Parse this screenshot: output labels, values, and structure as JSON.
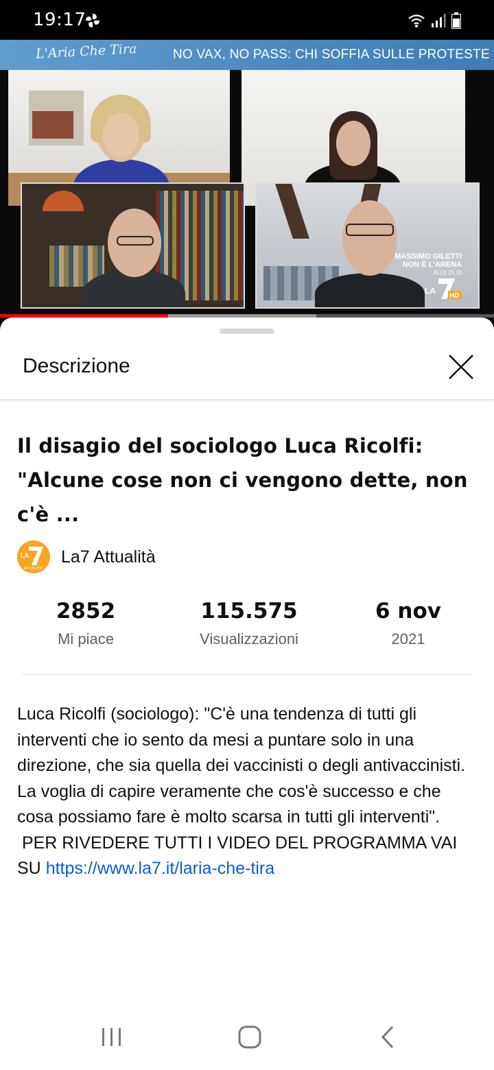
{
  "status_bar": {
    "time": "19:17",
    "app_icon": "pinwheel-notification-icon",
    "wifi_icon": "wifi-icon",
    "signal_icon": "signal-icon",
    "battery_icon": "battery-icon"
  },
  "video": {
    "banner_logo": "L'Aria Che Tira",
    "banner_headline": "NO VAX, NO PASS: CHI SOFFIA SULLE PROTESTE",
    "watermark_line1": "MASSIMO GILETTI",
    "watermark_line2": "NON È L'ARENA",
    "watermark_line3": "ALLE 21.15",
    "channel_mark": "LA7 HD",
    "progress": 0.34,
    "buffered": 0.64
  },
  "sheet": {
    "title": "Descrizione",
    "close_icon": "close-icon",
    "video_title": "Il disagio del sociologo Luca Ricolfi: \"Alcune cose non ci vengono dette, non c'è ...",
    "channel_name": "La7 Attualità",
    "stats": [
      {
        "value": "2852",
        "label": "Mi piace"
      },
      {
        "value": "115.575",
        "label": "Visualizzazioni"
      },
      {
        "value": "6 nov",
        "label": "2021"
      }
    ],
    "description_text": "Luca Ricolfi (sociologo): \"C'è una tendenza di tutti gli interventi che io sento da mesi a puntare solo in una direzione, che sia quella dei vaccinisti o degli antivaccinisti. La voglia di capire veramente che cos'è successo e che cosa possiamo fare è molto scarsa in tutti gli interventi\".\n PER RIVEDERE TUTTI I VIDEO DEL PROGRAMMA VAI SU ",
    "description_link": "https://www.la7.it/laria-che-tira"
  },
  "nav_bar": {
    "recents_icon": "recents-icon",
    "home_icon": "home-icon",
    "back_icon": "back-icon"
  },
  "colors": {
    "progress": "#ff0000",
    "link": "#065fd4",
    "avatar": "#f5a623",
    "banner": "#4a88c0"
  }
}
